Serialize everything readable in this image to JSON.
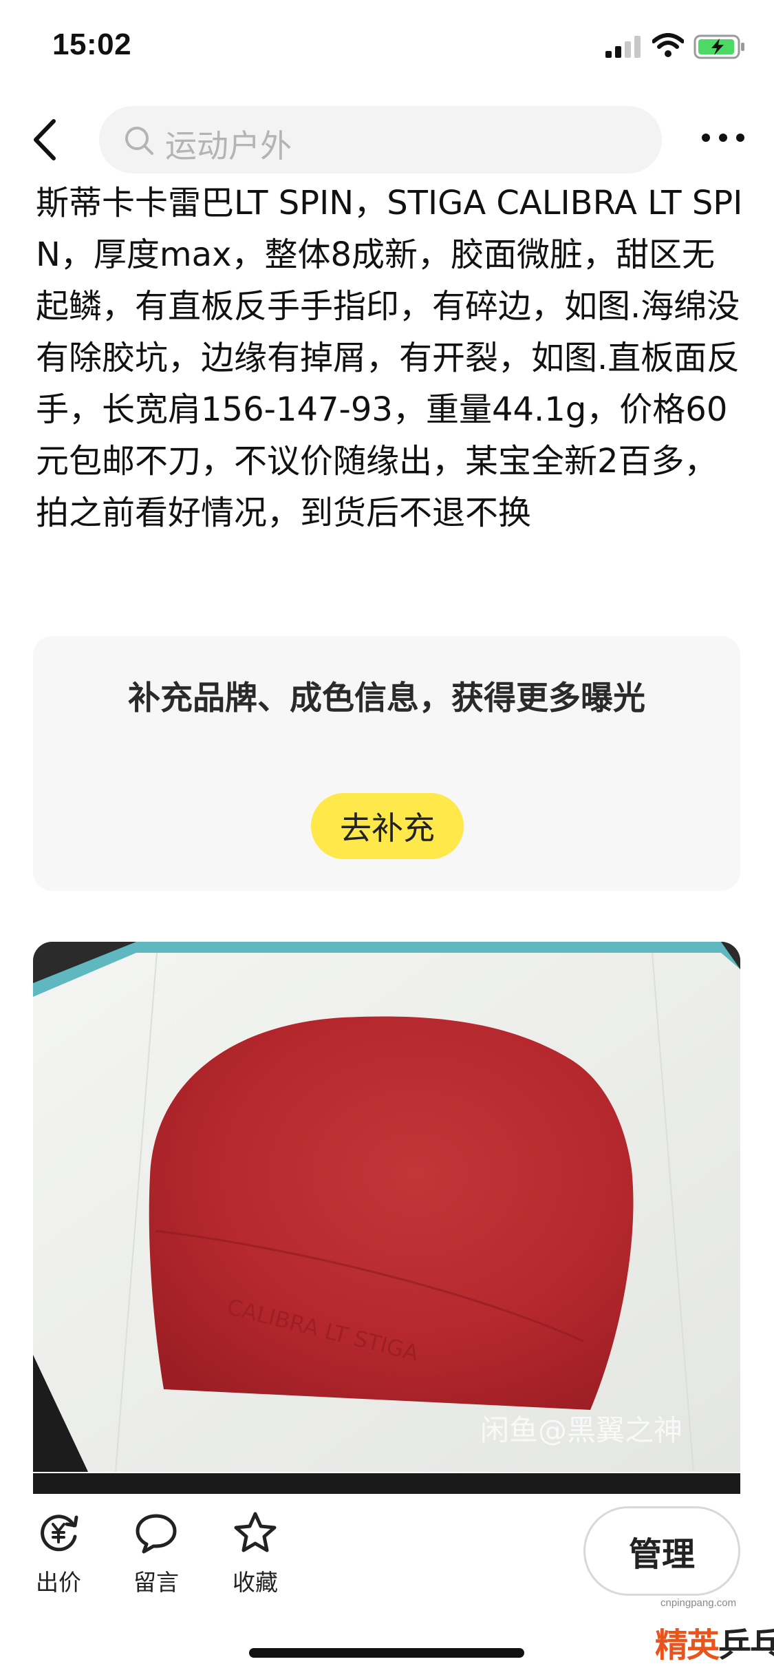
{
  "status_bar": {
    "time": "15:02"
  },
  "nav": {
    "search_placeholder": "运动户外"
  },
  "listing": {
    "description": "斯蒂卡卡雷巴LT SPIN，STIGA CALIBRA LT SPIN，厚度max，整体8成新，胶面微脏，甜区无起鳞，有直板反手手指印，有碎边，如图.海绵没有除胶坑，边缘有掉屑，有开裂，如图.直板面反手，长宽肩156-147-93，重量44.1g，价格60元包邮不刀，不议价随缘出，某宝全新2百多，拍之前看好情况，到货后不退不换"
  },
  "supplement": {
    "message": "补充品牌、成色信息，获得更多曝光",
    "button_label": "去补充",
    "button_color": "#ffe84a"
  },
  "photo": {
    "watermark": "闲鱼@黑翼之神",
    "rubber_color": "#b8262c"
  },
  "bottom_bar": {
    "actions": [
      {
        "label": "出价",
        "icon": "yuan-refresh-icon"
      },
      {
        "label": "留言",
        "icon": "speech-bubble-icon"
      },
      {
        "label": "收藏",
        "icon": "star-icon"
      }
    ],
    "manage_label": "管理"
  },
  "site_logo": {
    "url": "cnpingpang.com",
    "brand_a": "精英",
    "brand_b": "乒乓网"
  }
}
